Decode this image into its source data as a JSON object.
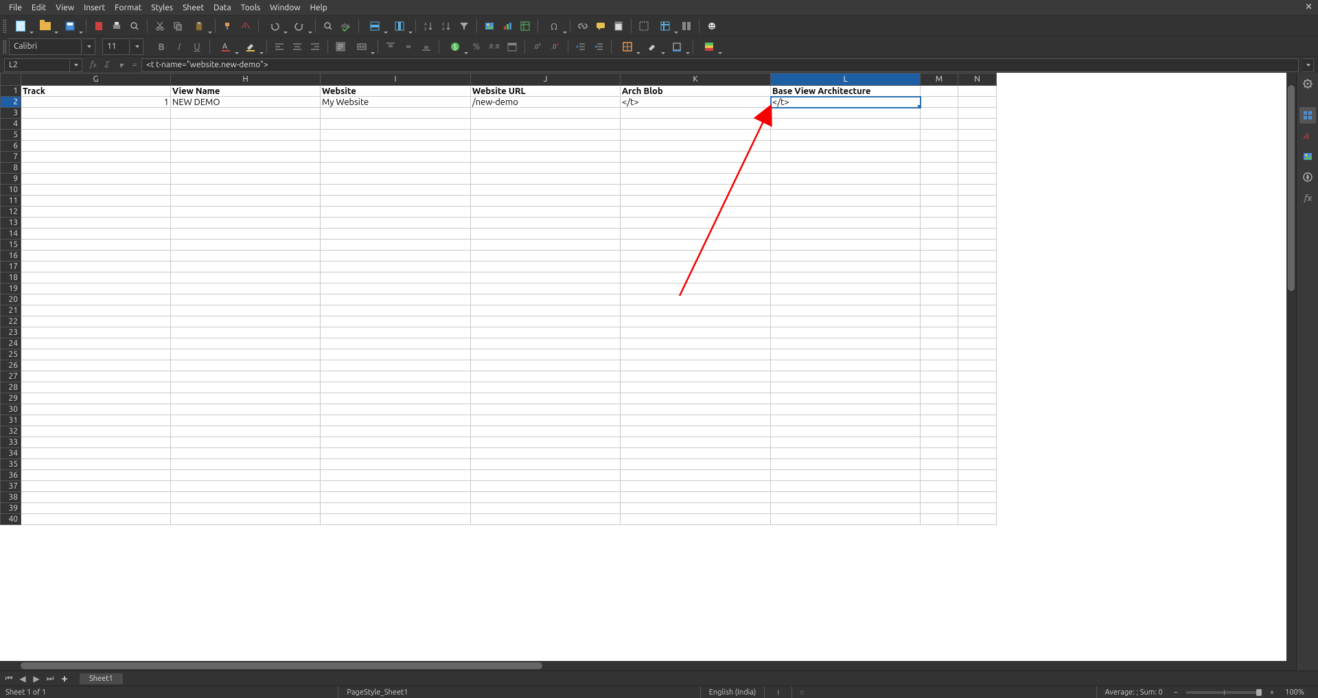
{
  "menubar": {
    "items": [
      "File",
      "Edit",
      "View",
      "Insert",
      "Format",
      "Styles",
      "Sheet",
      "Data",
      "Tools",
      "Window",
      "Help"
    ]
  },
  "toolbar2": {
    "font_name": "Calibri",
    "font_size": "11"
  },
  "formula_bar": {
    "cell_ref": "L2",
    "formula": "<t t-name=\"website.new-demo\">"
  },
  "columns": {
    "labels": [
      "G",
      "H",
      "I",
      "J",
      "K",
      "L",
      "M",
      "N"
    ],
    "widths": [
      218,
      218,
      219,
      218,
      219,
      218,
      55,
      56
    ],
    "selected": "L"
  },
  "rows": {
    "count": 40,
    "selected": 2
  },
  "data": {
    "header_row": {
      "G": "Track",
      "H": "View Name",
      "I": "Website",
      "J": "Website URL",
      "K": "Arch Blob",
      "L": "Base View Architecture"
    },
    "row2": {
      "G": "1",
      "H": "NEW DEMO",
      "I": "My Website",
      "J": "/new-demo",
      "K": "</t>",
      "L": "</t>"
    }
  },
  "active_cell": {
    "col": "L",
    "row": 2
  },
  "tabbar": {
    "sheet_name": "Sheet1"
  },
  "statusbar": {
    "sheet_info": "Sheet 1 of 1",
    "page_style": "PageStyle_Sheet1",
    "language": "English (India)",
    "calc": "Average: ; Sum: 0",
    "zoom": "100%"
  }
}
